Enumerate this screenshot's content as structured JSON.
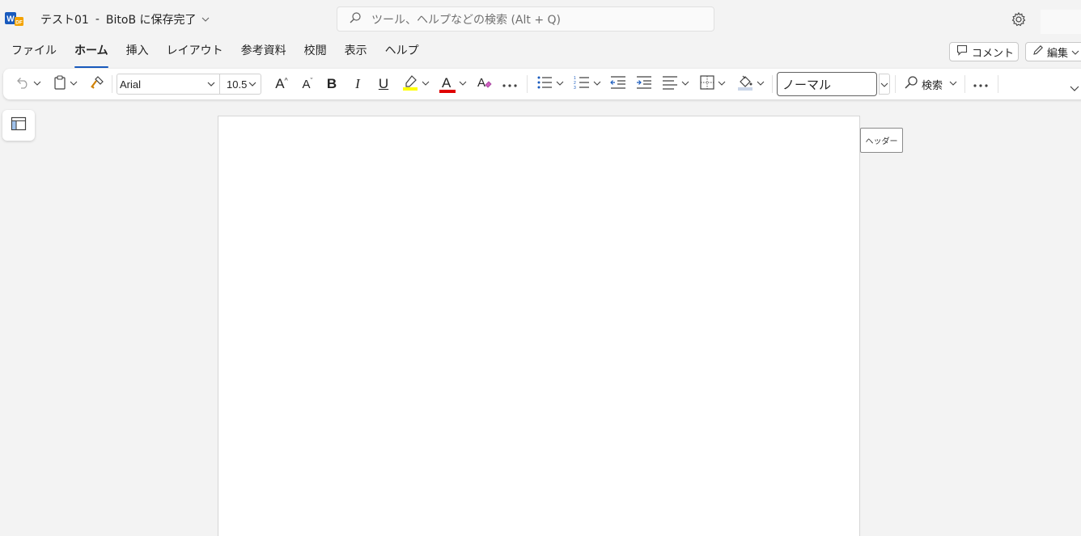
{
  "title_bar": {
    "doc_name": "テスト01",
    "separator": "-",
    "save_status": "BitoB に保存完了",
    "search_placeholder": "ツール、ヘルプなどの検索 (Alt + Q)"
  },
  "tabs": [
    {
      "label": "ファイル",
      "active": false
    },
    {
      "label": "ホーム",
      "active": true
    },
    {
      "label": "挿入",
      "active": false
    },
    {
      "label": "レイアウト",
      "active": false
    },
    {
      "label": "参考資料",
      "active": false
    },
    {
      "label": "校閲",
      "active": false
    },
    {
      "label": "表示",
      "active": false
    },
    {
      "label": "ヘルプ",
      "active": false
    }
  ],
  "actions": {
    "comment_label": "コメント",
    "edit_label": "編集"
  },
  "ribbon": {
    "font_name": "Arial",
    "font_size": "10.5",
    "bold_glyph": "B",
    "italic_glyph": "I",
    "underline_glyph": "U",
    "font_color_glyph": "A",
    "grow_font_glyph": "A",
    "shrink_font_glyph": "A",
    "style_name": "ノーマル",
    "find_label": "検索"
  },
  "document": {
    "header_tooltip": "ヘッダー"
  },
  "colors": {
    "accent": "#185abd",
    "highlight": "#ffff00",
    "font_color": "#e00000",
    "word_blue": "#185abd"
  }
}
